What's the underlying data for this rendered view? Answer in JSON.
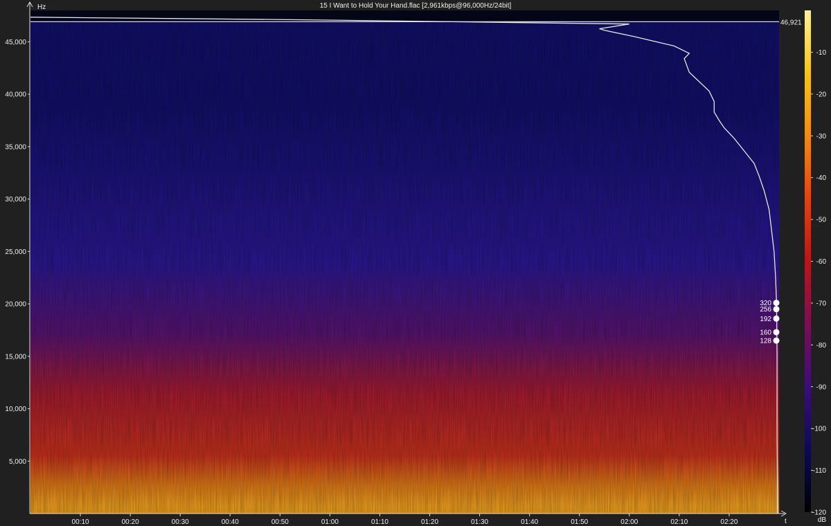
{
  "window": {
    "title": "15 I Want to Hold Your Hand.flac [2,961kbps@96,000Hz/24bit]"
  },
  "chart_data": {
    "type": "heatmap",
    "title": "15 I Want to Hold Your Hand.flac [2,961kbps@96,000Hz/24bit]",
    "ylabel": "Hz",
    "xlabel": "t",
    "colorbar_label": "dB",
    "ylim": [
      0,
      48000
    ],
    "xlim_seconds": [
      0,
      150
    ],
    "y_ticks": [
      {
        "value": 5000,
        "label": "5,000"
      },
      {
        "value": 10000,
        "label": "10,000"
      },
      {
        "value": 15000,
        "label": "15,000"
      },
      {
        "value": 20000,
        "label": "20,000"
      },
      {
        "value": 25000,
        "label": "25,000"
      },
      {
        "value": 30000,
        "label": "30,000"
      },
      {
        "value": 35000,
        "label": "35,000"
      },
      {
        "value": 40000,
        "label": "40,000"
      },
      {
        "value": 45000,
        "label": "45,000"
      }
    ],
    "x_ticks": [
      {
        "value": 10,
        "label": "00:10"
      },
      {
        "value": 20,
        "label": "00:20"
      },
      {
        "value": 30,
        "label": "00:30"
      },
      {
        "value": 40,
        "label": "00:40"
      },
      {
        "value": 50,
        "label": "00:50"
      },
      {
        "value": 60,
        "label": "01:00"
      },
      {
        "value": 70,
        "label": "01:10"
      },
      {
        "value": 80,
        "label": "01:20"
      },
      {
        "value": 90,
        "label": "01:30"
      },
      {
        "value": 100,
        "label": "01:40"
      },
      {
        "value": 110,
        "label": "01:50"
      },
      {
        "value": 120,
        "label": "02:00"
      },
      {
        "value": 130,
        "label": "02:10"
      },
      {
        "value": 140,
        "label": "02:20"
      }
    ],
    "colorbar_ticks": [
      {
        "value": -10,
        "label": "-10"
      },
      {
        "value": -20,
        "label": "-20"
      },
      {
        "value": -30,
        "label": "-30"
      },
      {
        "value": -40,
        "label": "-40"
      },
      {
        "value": -50,
        "label": "-50"
      },
      {
        "value": -60,
        "label": "-60"
      },
      {
        "value": -70,
        "label": "-70"
      },
      {
        "value": -80,
        "label": "-80"
      },
      {
        "value": -90,
        "label": "-90"
      },
      {
        "value": -100,
        "label": "-100"
      },
      {
        "value": -110,
        "label": "-110"
      },
      {
        "value": -120,
        "label": "-120"
      }
    ],
    "colorbar_range_db": [
      -120,
      0
    ],
    "colorbar_colors": [
      "#000000",
      "#0c0a55",
      "#3b0e7a",
      "#7a0f52",
      "#b8161a",
      "#e04412",
      "#f08a16",
      "#f5c21c",
      "#fff09a"
    ],
    "spectrum_bands": [
      {
        "hz_from": 0,
        "hz_to": 1500,
        "color": "#f0a020"
      },
      {
        "hz_from": 1500,
        "hz_to": 4000,
        "color": "#e07a18"
      },
      {
        "hz_from": 4000,
        "hz_to": 7000,
        "color": "#c8321c"
      },
      {
        "hz_from": 7000,
        "hz_to": 16000,
        "color": "#a51c30"
      },
      {
        "hz_from": 16000,
        "hz_to": 18000,
        "color": "#5a1470"
      },
      {
        "hz_from": 18000,
        "hz_to": 30000,
        "color": "#2a1892"
      },
      {
        "hz_from": 30000,
        "hz_to": 48000,
        "color": "#12106a"
      }
    ],
    "cutoff_line": {
      "value_hz": 46921,
      "label": "46,921"
    },
    "bitrate_markers": [
      {
        "label": "320",
        "hz": 20100
      },
      {
        "label": "256",
        "hz": 19500
      },
      {
        "label": "192",
        "hz": 18600
      },
      {
        "label": "160",
        "hz": 17300
      },
      {
        "label": "128",
        "hz": 16500
      }
    ],
    "max_freq_curve": [
      {
        "t": 0,
        "hz": 47350
      },
      {
        "t": 55,
        "hz": 47100
      },
      {
        "t": 120,
        "hz": 46700
      },
      {
        "t": 114,
        "hz": 46250
      },
      {
        "t": 115,
        "hz": 46100
      },
      {
        "t": 121,
        "hz": 45500
      },
      {
        "t": 129,
        "hz": 44600
      },
      {
        "t": 132,
        "hz": 43900
      },
      {
        "t": 131,
        "hz": 43400
      },
      {
        "t": 132,
        "hz": 42100
      },
      {
        "t": 134,
        "hz": 41200
      },
      {
        "t": 136,
        "hz": 40300
      },
      {
        "t": 137,
        "hz": 39300
      },
      {
        "t": 137,
        "hz": 38300
      },
      {
        "t": 138,
        "hz": 37500
      },
      {
        "t": 139,
        "hz": 36800
      },
      {
        "t": 141,
        "hz": 35800
      },
      {
        "t": 143,
        "hz": 34600
      },
      {
        "t": 145,
        "hz": 33400
      },
      {
        "t": 146,
        "hz": 32200
      },
      {
        "t": 147,
        "hz": 30800
      },
      {
        "t": 148,
        "hz": 29000
      },
      {
        "t": 148.5,
        "hz": 27000
      },
      {
        "t": 149,
        "hz": 25000
      },
      {
        "t": 149.3,
        "hz": 22500
      },
      {
        "t": 149.5,
        "hz": 20000
      },
      {
        "t": 149.6,
        "hz": 15000
      },
      {
        "t": 149.6,
        "hz": 8000
      },
      {
        "t": 149.7,
        "hz": 0
      }
    ]
  }
}
